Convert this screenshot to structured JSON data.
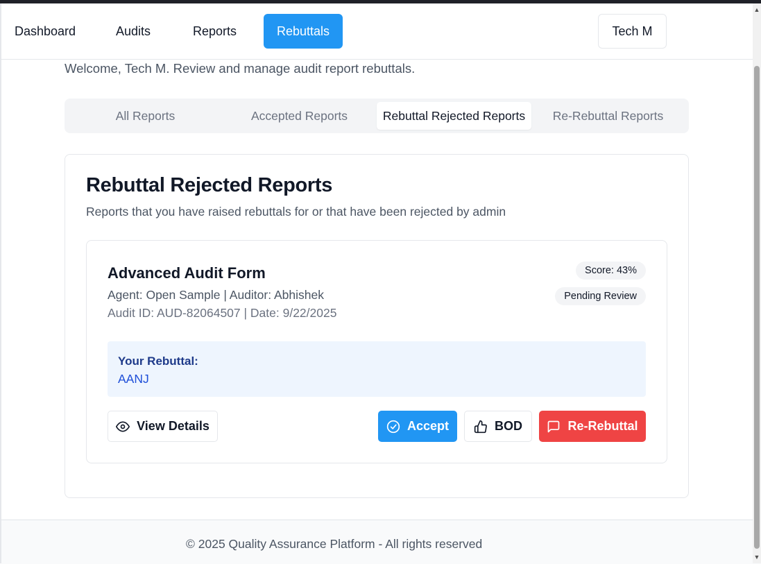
{
  "nav": {
    "items": [
      {
        "label": "Dashboard"
      },
      {
        "label": "Audits"
      },
      {
        "label": "Reports"
      },
      {
        "label": "Rebuttals"
      }
    ],
    "active": "Rebuttals",
    "user_label": "Tech M"
  },
  "welcome_text": "Welcome, Tech M. Review and manage audit report rebuttals.",
  "tabs": [
    {
      "label": "All Reports"
    },
    {
      "label": "Accepted Reports"
    },
    {
      "label": "Rebuttal Rejected Reports"
    },
    {
      "label": "Re-Rebuttal Reports"
    }
  ],
  "active_tab": "Rebuttal Rejected Reports",
  "section": {
    "title": "Rebuttal Rejected Reports",
    "subtitle": "Reports that you have raised rebuttals for or that have been rejected by admin"
  },
  "report": {
    "title": "Advanced Audit Form",
    "meta_line1": "Agent: Open Sample | Auditor: Abhishek",
    "meta_line2": "Audit ID: AUD-82064507 | Date: 9/22/2025",
    "score_badge": "Score: 43%",
    "status_badge": "Pending Review",
    "rebuttal_label": "Your Rebuttal:",
    "rebuttal_text": "AANJ",
    "actions": {
      "view": "View Details",
      "accept": "Accept",
      "bod": "BOD",
      "rerebuttal": "Re-Rebuttal"
    }
  },
  "icons": {
    "view": "eye-icon",
    "accept": "check-circle-icon",
    "bod": "thumbs-up-icon",
    "rerebuttal": "message-square-icon"
  },
  "footer_text": "© 2025 Quality Assurance Platform - All rights reserved",
  "colors": {
    "primary": "#2196f3",
    "danger": "#ef4444",
    "rebuttal_bg": "#eef5fe",
    "rebuttal_label": "#1e3a8a"
  }
}
